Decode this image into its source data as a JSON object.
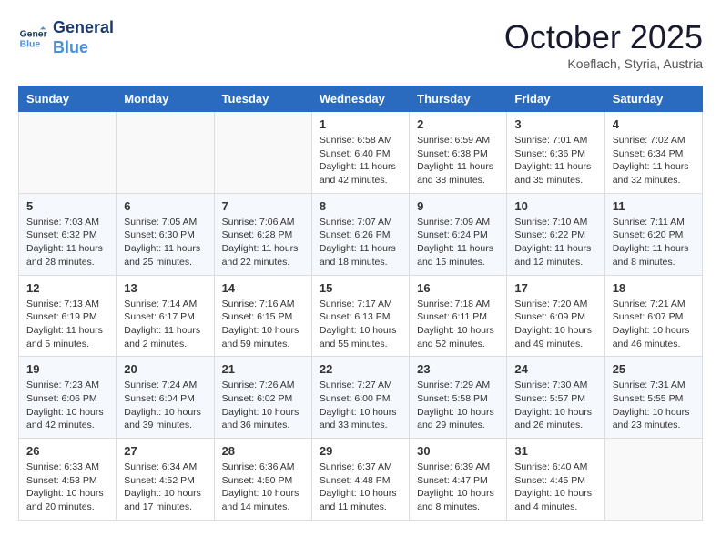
{
  "header": {
    "logo_line1": "General",
    "logo_line2": "Blue",
    "month": "October 2025",
    "location": "Koeflach, Styria, Austria"
  },
  "weekdays": [
    "Sunday",
    "Monday",
    "Tuesday",
    "Wednesday",
    "Thursday",
    "Friday",
    "Saturday"
  ],
  "weeks": [
    [
      {
        "day": "",
        "info": ""
      },
      {
        "day": "",
        "info": ""
      },
      {
        "day": "",
        "info": ""
      },
      {
        "day": "1",
        "info": "Sunrise: 6:58 AM\nSunset: 6:40 PM\nDaylight: 11 hours and 42 minutes."
      },
      {
        "day": "2",
        "info": "Sunrise: 6:59 AM\nSunset: 6:38 PM\nDaylight: 11 hours and 38 minutes."
      },
      {
        "day": "3",
        "info": "Sunrise: 7:01 AM\nSunset: 6:36 PM\nDaylight: 11 hours and 35 minutes."
      },
      {
        "day": "4",
        "info": "Sunrise: 7:02 AM\nSunset: 6:34 PM\nDaylight: 11 hours and 32 minutes."
      }
    ],
    [
      {
        "day": "5",
        "info": "Sunrise: 7:03 AM\nSunset: 6:32 PM\nDaylight: 11 hours and 28 minutes."
      },
      {
        "day": "6",
        "info": "Sunrise: 7:05 AM\nSunset: 6:30 PM\nDaylight: 11 hours and 25 minutes."
      },
      {
        "day": "7",
        "info": "Sunrise: 7:06 AM\nSunset: 6:28 PM\nDaylight: 11 hours and 22 minutes."
      },
      {
        "day": "8",
        "info": "Sunrise: 7:07 AM\nSunset: 6:26 PM\nDaylight: 11 hours and 18 minutes."
      },
      {
        "day": "9",
        "info": "Sunrise: 7:09 AM\nSunset: 6:24 PM\nDaylight: 11 hours and 15 minutes."
      },
      {
        "day": "10",
        "info": "Sunrise: 7:10 AM\nSunset: 6:22 PM\nDaylight: 11 hours and 12 minutes."
      },
      {
        "day": "11",
        "info": "Sunrise: 7:11 AM\nSunset: 6:20 PM\nDaylight: 11 hours and 8 minutes."
      }
    ],
    [
      {
        "day": "12",
        "info": "Sunrise: 7:13 AM\nSunset: 6:19 PM\nDaylight: 11 hours and 5 minutes."
      },
      {
        "day": "13",
        "info": "Sunrise: 7:14 AM\nSunset: 6:17 PM\nDaylight: 11 hours and 2 minutes."
      },
      {
        "day": "14",
        "info": "Sunrise: 7:16 AM\nSunset: 6:15 PM\nDaylight: 10 hours and 59 minutes."
      },
      {
        "day": "15",
        "info": "Sunrise: 7:17 AM\nSunset: 6:13 PM\nDaylight: 10 hours and 55 minutes."
      },
      {
        "day": "16",
        "info": "Sunrise: 7:18 AM\nSunset: 6:11 PM\nDaylight: 10 hours and 52 minutes."
      },
      {
        "day": "17",
        "info": "Sunrise: 7:20 AM\nSunset: 6:09 PM\nDaylight: 10 hours and 49 minutes."
      },
      {
        "day": "18",
        "info": "Sunrise: 7:21 AM\nSunset: 6:07 PM\nDaylight: 10 hours and 46 minutes."
      }
    ],
    [
      {
        "day": "19",
        "info": "Sunrise: 7:23 AM\nSunset: 6:06 PM\nDaylight: 10 hours and 42 minutes."
      },
      {
        "day": "20",
        "info": "Sunrise: 7:24 AM\nSunset: 6:04 PM\nDaylight: 10 hours and 39 minutes."
      },
      {
        "day": "21",
        "info": "Sunrise: 7:26 AM\nSunset: 6:02 PM\nDaylight: 10 hours and 36 minutes."
      },
      {
        "day": "22",
        "info": "Sunrise: 7:27 AM\nSunset: 6:00 PM\nDaylight: 10 hours and 33 minutes."
      },
      {
        "day": "23",
        "info": "Sunrise: 7:29 AM\nSunset: 5:58 PM\nDaylight: 10 hours and 29 minutes."
      },
      {
        "day": "24",
        "info": "Sunrise: 7:30 AM\nSunset: 5:57 PM\nDaylight: 10 hours and 26 minutes."
      },
      {
        "day": "25",
        "info": "Sunrise: 7:31 AM\nSunset: 5:55 PM\nDaylight: 10 hours and 23 minutes."
      }
    ],
    [
      {
        "day": "26",
        "info": "Sunrise: 6:33 AM\nSunset: 4:53 PM\nDaylight: 10 hours and 20 minutes."
      },
      {
        "day": "27",
        "info": "Sunrise: 6:34 AM\nSunset: 4:52 PM\nDaylight: 10 hours and 17 minutes."
      },
      {
        "day": "28",
        "info": "Sunrise: 6:36 AM\nSunset: 4:50 PM\nDaylight: 10 hours and 14 minutes."
      },
      {
        "day": "29",
        "info": "Sunrise: 6:37 AM\nSunset: 4:48 PM\nDaylight: 10 hours and 11 minutes."
      },
      {
        "day": "30",
        "info": "Sunrise: 6:39 AM\nSunset: 4:47 PM\nDaylight: 10 hours and 8 minutes."
      },
      {
        "day": "31",
        "info": "Sunrise: 6:40 AM\nSunset: 4:45 PM\nDaylight: 10 hours and 4 minutes."
      },
      {
        "day": "",
        "info": ""
      }
    ]
  ]
}
